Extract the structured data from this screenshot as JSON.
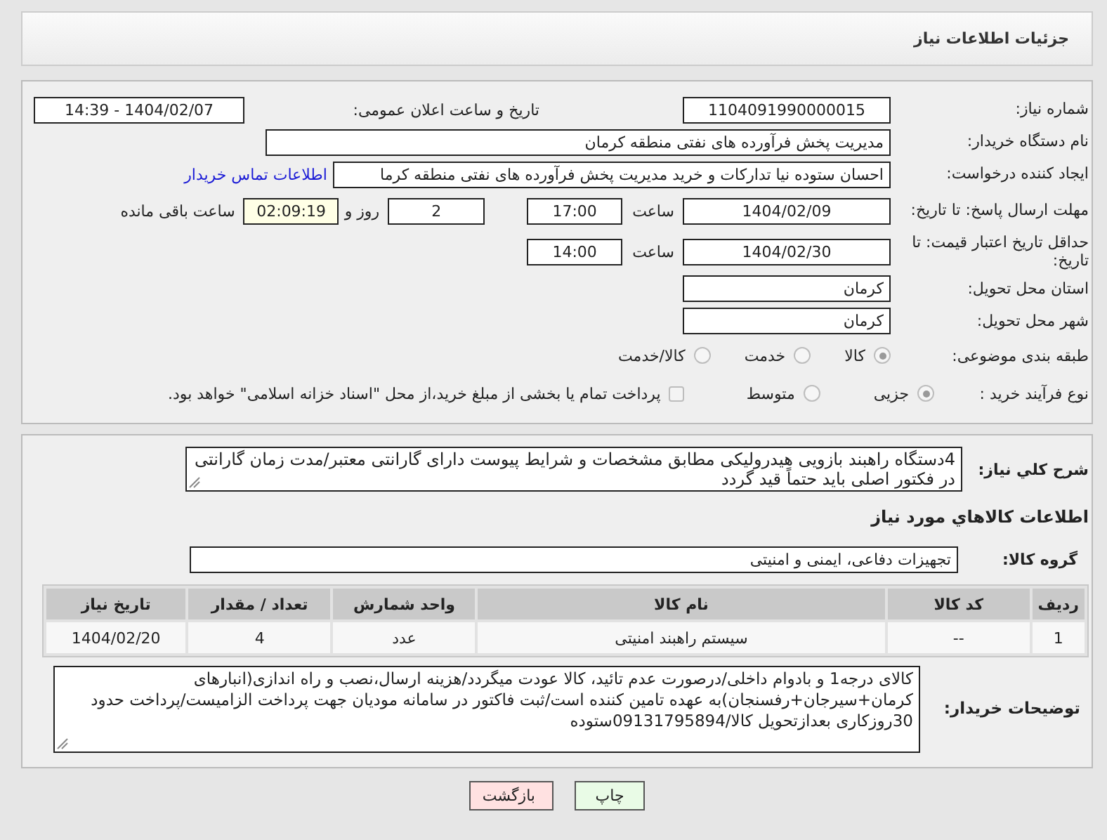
{
  "header": {
    "title": "جزئیات اطلاعات نیاز"
  },
  "need_info": {
    "need_number": {
      "label": "شماره نیاز:",
      "value": "1104091990000015"
    },
    "announce_datetime": {
      "label": "تاریخ و ساعت اعلان عمومی:",
      "value": "1404/02/07 - 14:39"
    },
    "buyer_org": {
      "label": "نام دستگاه خریدار:",
      "value": "مدیریت پخش فرآورده های نفتی منطقه کرمان"
    },
    "requester": {
      "label": "ایجاد کننده درخواست:",
      "value": "احسان  ستوده نیا  تدارکات و خرید  مدیریت پخش فرآورده های نفتی منطقه کرما",
      "link": "اطلاعات تماس خریدار"
    },
    "response_deadline": {
      "label": "مهلت ارسال پاسخ: تا تاریخ:",
      "date": "1404/02/09",
      "time_label": "ساعت",
      "time": "17:00",
      "days": "2",
      "days_label": "روز و",
      "remaining": "02:09:19",
      "remaining_label": "ساعت باقی مانده"
    },
    "price_validity": {
      "label": "حداقل تاریخ اعتبار قیمت: تا تاریخ:",
      "date": "1404/02/30",
      "time_label": "ساعت",
      "time": "14:00"
    },
    "province": {
      "label": "استان محل تحویل:",
      "value": "کرمان"
    },
    "city": {
      "label": "شهر محل تحویل:",
      "value": "کرمان"
    },
    "category": {
      "label": "طبقه بندی موضوعی:",
      "options": [
        {
          "label": "کالا",
          "selected": true
        },
        {
          "label": "خدمت",
          "selected": false
        },
        {
          "label": "کالا/خدمت",
          "selected": false
        }
      ]
    },
    "purchase_type": {
      "label": "نوع فرآیند خرید :",
      "options": [
        {
          "label": "جزیی",
          "selected": true
        },
        {
          "label": "متوسط",
          "selected": false
        }
      ],
      "treasury": {
        "label": "پرداخت تمام یا بخشی از مبلغ خرید،از محل \"اسناد خزانه اسلامی\" خواهد بود.",
        "checked": false
      }
    }
  },
  "goods": {
    "description": {
      "label": "شرح کلي نياز:",
      "value": "4دستگاه راهبند بازویی هیدرولیکی مطابق مشخصات و شرایط پیوست دارای گارانتی معتبر/مدت زمان گارانتی در فکتور اصلی باید حتماً قید گردد"
    },
    "section_title": "اطلاعات كالاهاي مورد نياز",
    "group": {
      "label": "گروه کالا:",
      "value": "تجهیزات دفاعی، ایمنی و امنیتی"
    },
    "table": {
      "columns": [
        "ردیف",
        "کد کالا",
        "نام کالا",
        "واحد شمارش",
        "تعداد / مقدار",
        "تاریخ نیاز"
      ],
      "rows": [
        [
          "1",
          "--",
          "سیستم راهبند امنیتی",
          "عدد",
          "4",
          "1404/02/20"
        ]
      ]
    },
    "buyer_notes": {
      "label": "توضیحات خریدار:",
      "value": "کالای درجه1 و بادوام داخلی/درصورت عدم تائید، کالا عودت میگردد/هزینه ارسال،نصب و راه اندازی(انبارهای کرمان+سیرجان+رفسنجان)به عهده تامین کننده است/ثبت فاکتور در سامانه مودیان جهت پرداخت الزامیست/پرداخت حدود 30روزکاری بعدازتحویل کالا/09131795894ستوده"
    }
  },
  "buttons": [
    {
      "label": "چاپ",
      "kind": "print"
    },
    {
      "label": "بازگشت",
      "kind": "back"
    }
  ]
}
